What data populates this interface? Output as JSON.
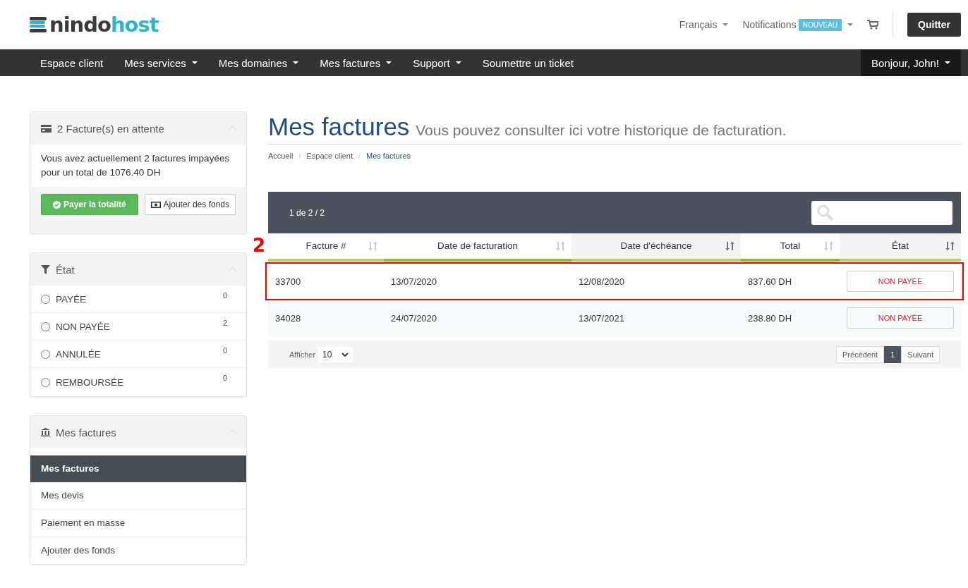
{
  "logo": {
    "dark": "nindo",
    "accent": "host"
  },
  "top_links": [
    {
      "label": "Français",
      "caret": true
    },
    {
      "label": "Notifications",
      "badge": "NOUVEAU",
      "caret": true
    }
  ],
  "logout_button": "Quitter",
  "nav": [
    {
      "label": "Espace client",
      "caret": false
    },
    {
      "label": "Mes services",
      "caret": true
    },
    {
      "label": "Mes domaines",
      "caret": true
    },
    {
      "label": "Mes factures",
      "caret": true
    },
    {
      "label": "Support",
      "caret": true
    },
    {
      "label": "Soumettre un ticket",
      "caret": false
    }
  ],
  "user_menu": "Bonjour, John!",
  "pending_panel": {
    "title": "2 Facture(s) en attente",
    "text": "Vous avez actuellement 2 factures impayées pour un total de 1076.40 DH",
    "pay_button": "Payer la totalité",
    "funds_button": "Ajouter des fonds"
  },
  "status_panel": {
    "title": "État",
    "items": [
      {
        "label": "PAYÉE",
        "count": "0",
        "selected": false
      },
      {
        "label": "NON PAYÉE",
        "count": "2",
        "selected": false
      },
      {
        "label": "ANNULÉE",
        "count": "0",
        "selected": false
      },
      {
        "label": "REMBOURSÉE",
        "count": "0",
        "selected": false
      }
    ]
  },
  "invoices_panel": {
    "title": "Mes factures",
    "items": [
      {
        "label": "Mes factures",
        "selected": true
      },
      {
        "label": "Mes devis",
        "selected": false
      },
      {
        "label": "Paiement en masse",
        "selected": false
      },
      {
        "label": "Ajouter des fonds",
        "selected": false
      }
    ]
  },
  "page_title": "Mes factures",
  "page_subtitle": "Vous pouvez consulter ici votre historique de facturation.",
  "breadcrumb": [
    {
      "label": "Accueil",
      "selected": false
    },
    {
      "separator": "/",
      "label": "Espace client",
      "selected": false
    },
    {
      "separator": "/",
      "label": "Mes factures",
      "selected": true
    }
  ],
  "table": {
    "info": "1 de 2 / 2",
    "columns": [
      {
        "label": "Facture #",
        "sorted": false
      },
      {
        "label": "Date de facturation",
        "sorted": false
      },
      {
        "label": "Date d'échéance",
        "sorted": true
      },
      {
        "label": "Total",
        "sorted": false
      },
      {
        "label": "État",
        "sorted": true
      }
    ],
    "rows": [
      {
        "cells": [
          "33700",
          "13/07/2020",
          "12/08/2020",
          "837.60 DH"
        ],
        "status": "NON PAYÉE",
        "highlighted": true
      },
      {
        "cells": [
          "34028",
          "24/07/2020",
          "13/07/2021",
          "238.80 DH"
        ],
        "status": "NON PAYÉE",
        "highlighted": false
      }
    ],
    "annotation": "2",
    "show_label": "Afficher",
    "page_size": "10",
    "prev": "Précédent",
    "pages": [
      {
        "label": "1",
        "selected": true
      }
    ],
    "next": "Suivant"
  }
}
